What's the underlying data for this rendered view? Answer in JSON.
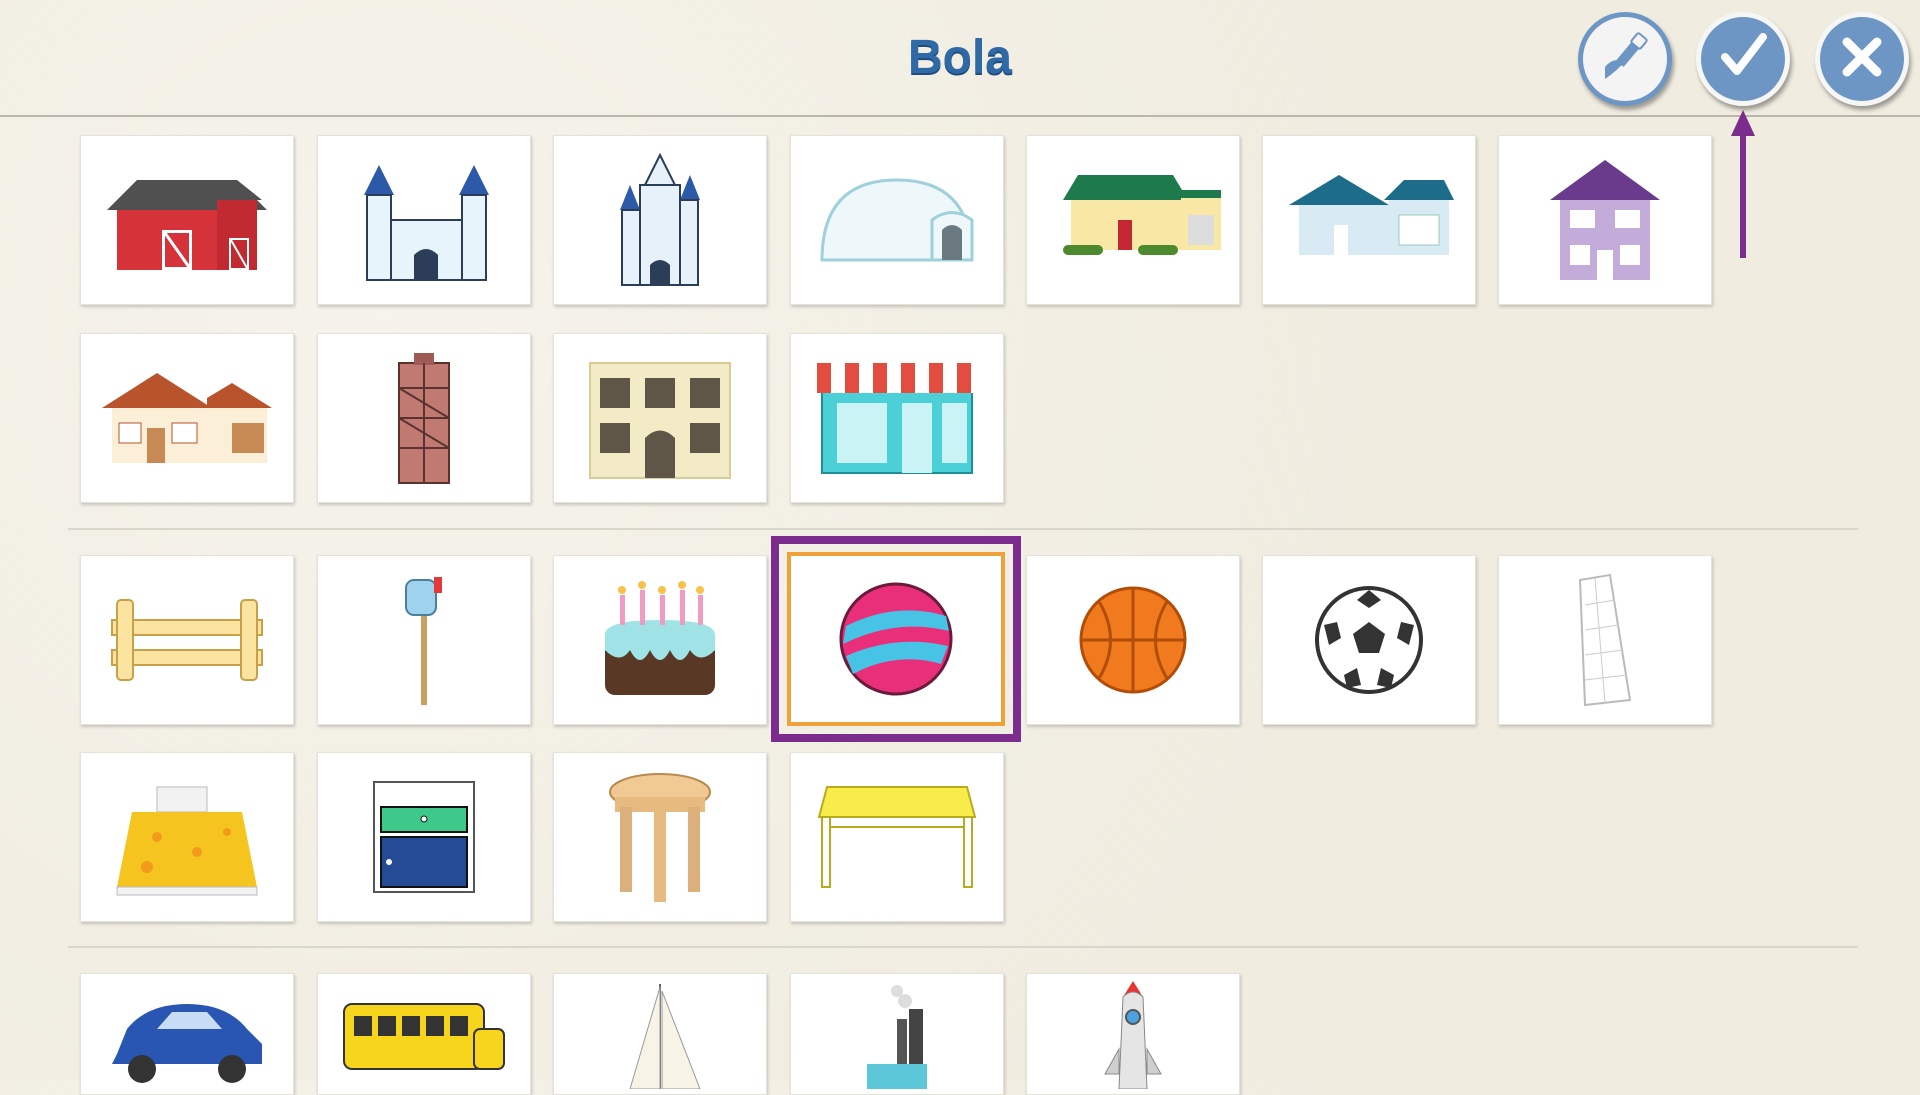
{
  "header": {
    "title": "Bola",
    "buttons": [
      {
        "name": "paint-button",
        "icon": "paintbrush-icon"
      },
      {
        "name": "confirm-button",
        "icon": "checkmark-icon"
      },
      {
        "name": "close-button",
        "icon": "close-icon"
      }
    ],
    "hint_arrow_color": "#7b2c8c"
  },
  "colors": {
    "title": "#2f6aa6",
    "button_blue": "#6d96c4",
    "selection_outer": "#7b2c8c",
    "selection_inner": "#f0a23a",
    "background": "#f0ece0"
  },
  "sections": [
    {
      "name": "buildings",
      "items": [
        "barn",
        "castle-small",
        "castle-tall",
        "igloo",
        "house-green-roof",
        "house-blue",
        "house-purple",
        "house-brown",
        "tower-brick",
        "apartment",
        "shop"
      ]
    },
    {
      "name": "objects",
      "items": [
        "fence",
        "mailbox",
        "birthday-cake",
        "ball",
        "basketball",
        "soccer-ball",
        "goal-net",
        "bed",
        "nightstand",
        "stool",
        "table"
      ],
      "selected": "ball"
    },
    {
      "name": "vehicles",
      "items": [
        "car",
        "school-bus",
        "sailboat",
        "factory",
        "rocket"
      ]
    }
  ]
}
